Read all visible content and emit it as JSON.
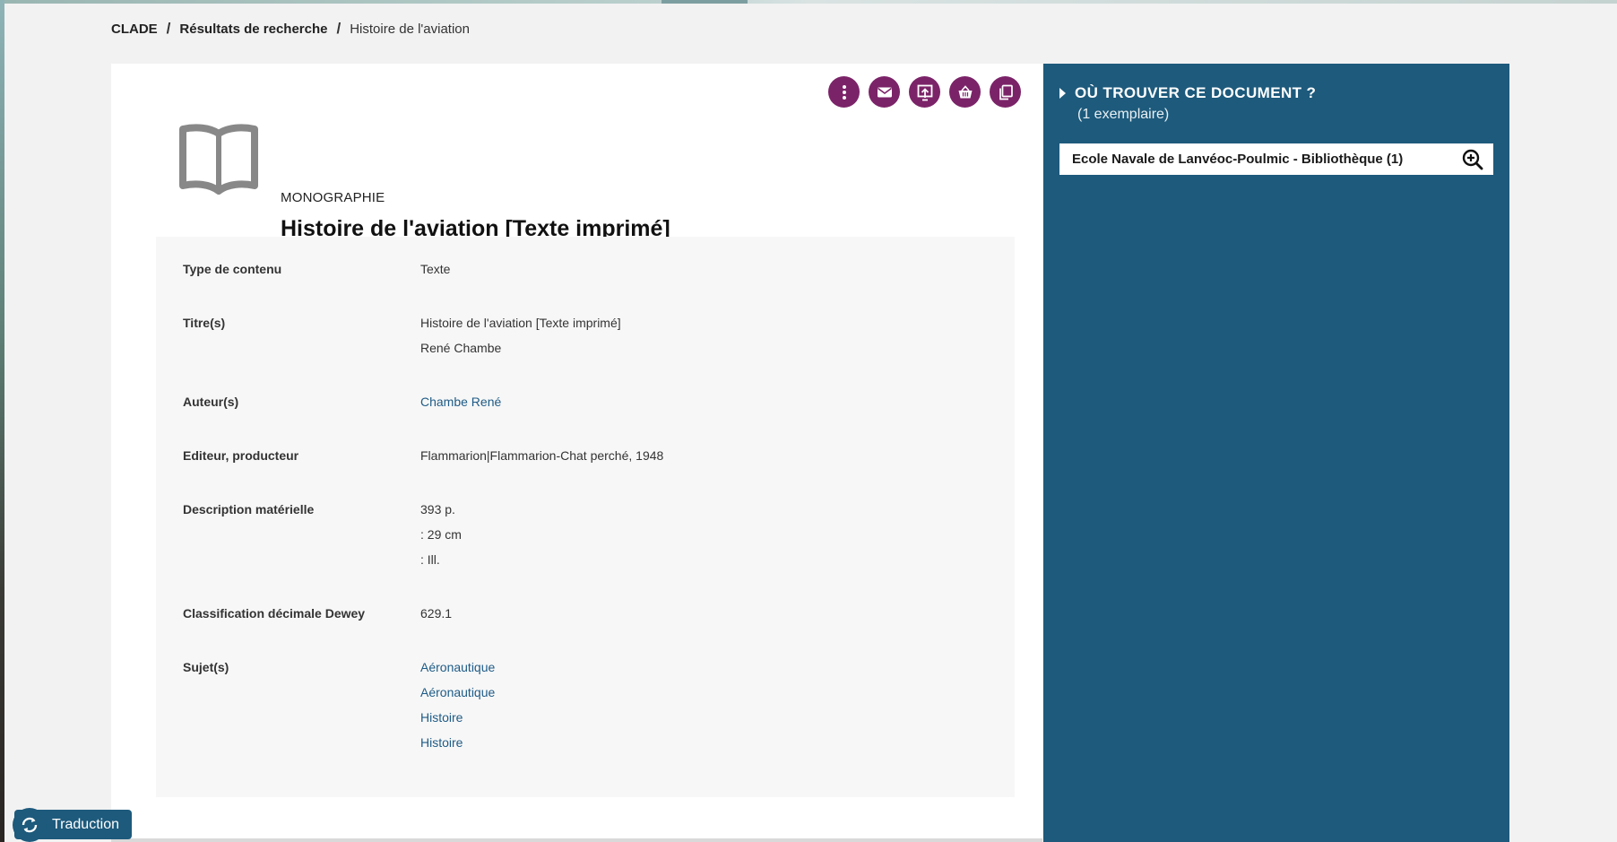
{
  "breadcrumb": {
    "root": "CLADE",
    "separator": "/",
    "results": "Résultats de recherche",
    "current": "Histoire de l'aviation"
  },
  "actions": [
    {
      "name": "more-options",
      "icon": "vertical-dots-icon"
    },
    {
      "name": "email",
      "icon": "envelope-icon"
    },
    {
      "name": "export",
      "icon": "export-icon"
    },
    {
      "name": "basket",
      "icon": "basket-icon"
    },
    {
      "name": "copy",
      "icon": "copy-icon"
    }
  ],
  "document": {
    "type": "MONOGRAPHIE",
    "title": "Histoire de l'aviation [Texte imprimé]",
    "icon": "open-book-icon"
  },
  "details": [
    {
      "label": "Type de contenu",
      "values": [
        {
          "text": "Texte",
          "link": false
        }
      ]
    },
    {
      "label": "Titre(s)",
      "values": [
        {
          "text": "Histoire de l'aviation [Texte imprimé]",
          "link": false
        },
        {
          "text": "René Chambe",
          "link": false
        }
      ]
    },
    {
      "label": "Auteur(s)",
      "values": [
        {
          "text": "Chambe René",
          "link": true
        }
      ]
    },
    {
      "label": "Editeur, producteur",
      "values": [
        {
          "text": "Flammarion|Flammarion-Chat perché, 1948",
          "link": false
        }
      ]
    },
    {
      "label": "Description matérielle",
      "values": [
        {
          "text": "393 p.",
          "link": false
        },
        {
          "text": ": 29 cm",
          "link": false
        },
        {
          "text": ": Ill.",
          "link": false
        }
      ]
    },
    {
      "label": "Classification décimale Dewey",
      "values": [
        {
          "text": "629.1",
          "link": false
        }
      ]
    },
    {
      "label": "Sujet(s)",
      "values": [
        {
          "text": "Aéronautique",
          "link": true
        },
        {
          "text": "Aéronautique",
          "link": true
        },
        {
          "text": "Histoire",
          "link": true
        },
        {
          "text": "Histoire",
          "link": true
        }
      ]
    }
  ],
  "availability": {
    "heading": "OÙ TROUVER CE DOCUMENT ?",
    "count": "(1 exemplaire)",
    "library": "Ecole Navale de Lanvéoc-Poulmic - Bibliothèque (1)",
    "zoom_icon": "zoom-in-icon"
  },
  "translate": {
    "label": "Traduction",
    "icon": "sync-icon"
  },
  "colors": {
    "accent": "#7b2368",
    "panel": "#1d5a7c",
    "link": "#1e5b86"
  }
}
